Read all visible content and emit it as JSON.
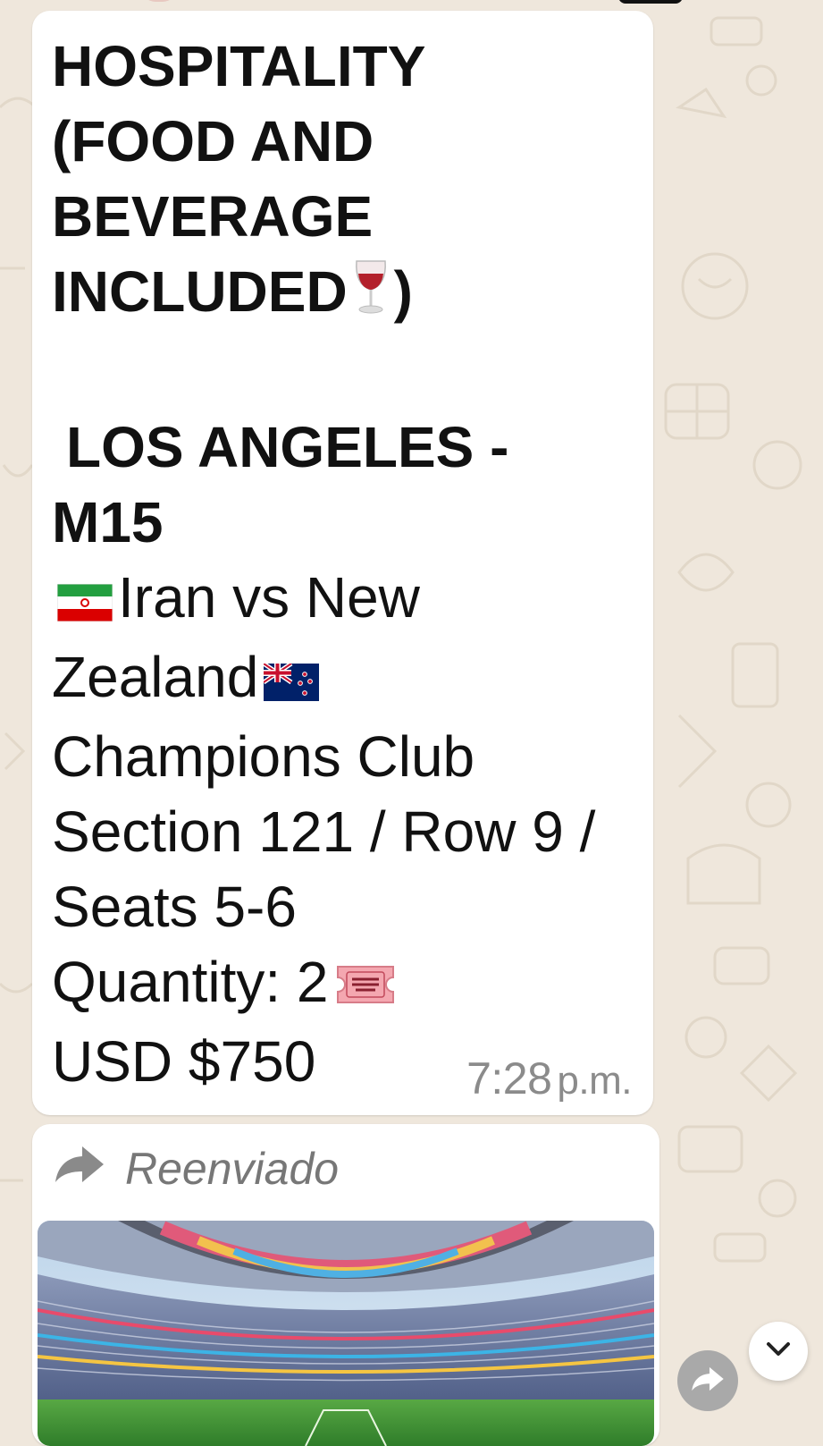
{
  "message": {
    "heading_lines": [
      "HOSPITALITY",
      "(FOOD AND",
      "BEVERAGE",
      "INCLUDED"
    ],
    "heading_close": ")",
    "city_line": "LOS ANGELES -",
    "match_code": "M15",
    "match_home": "Iran vs New",
    "match_away": "Zealand",
    "section_name": "Champions Club",
    "location_line_1": "Section 121 / Row 9 /",
    "location_line_2": "Seats 5-6",
    "quantity": "Quantity: 2",
    "price": "USD $750",
    "time": "7:28",
    "ampm": "p.m.",
    "emoji": {
      "wine": "wine-glass-icon",
      "flag_home": "iran-flag-icon",
      "flag_away": "new-zealand-flag-icon",
      "ticket": "admit-one-ticket-icon"
    }
  },
  "forwarded": {
    "label": "Reenviado",
    "image": "stadium-photo"
  },
  "colors": {
    "chat_background": "#efe7dc",
    "bubble": "#ffffff",
    "text": "#111111",
    "meta_text": "#8b8b8b"
  }
}
